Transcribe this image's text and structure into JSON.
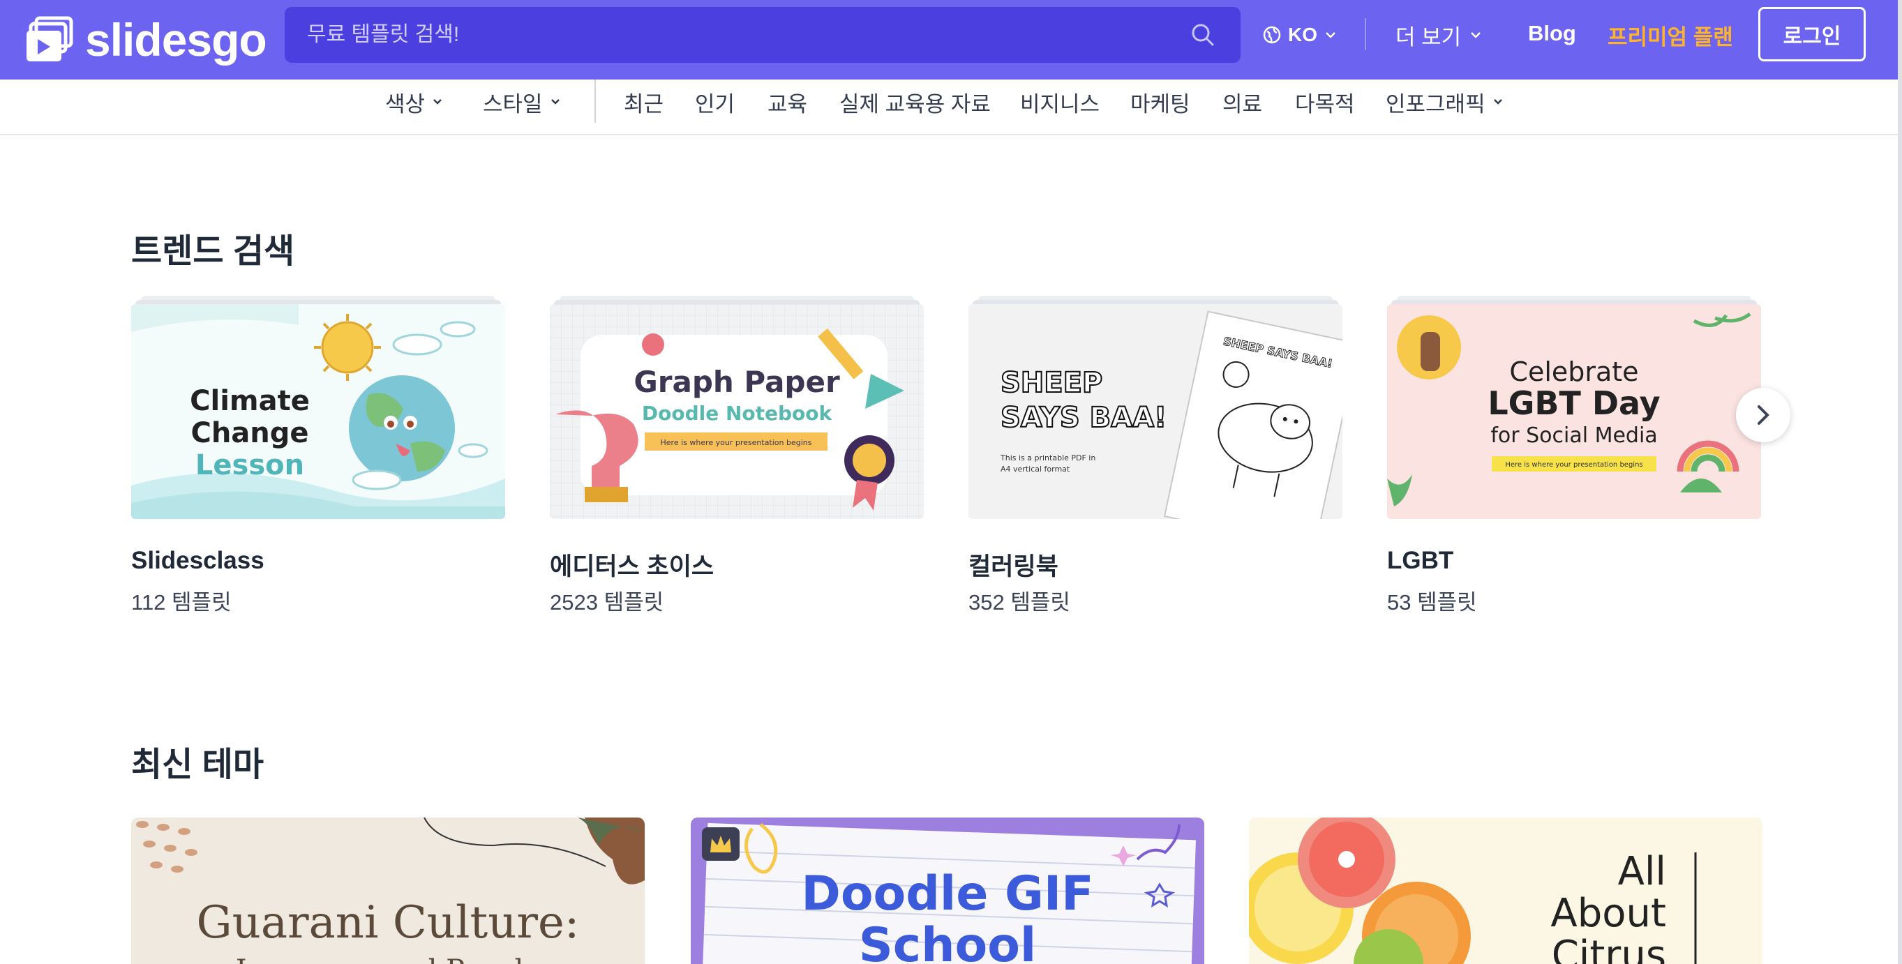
{
  "header": {
    "logo_text": "slidesgo",
    "search_placeholder": "무료 템플릿 검색!",
    "language": "KO",
    "more_label": "더 보기",
    "blog_label": "Blog",
    "premium_label": "프리미엄 플랜",
    "login_label": "로그인",
    "colors": {
      "bar": "#6c63f0",
      "search": "#4b3fe0",
      "premium": "#ffb32b"
    }
  },
  "nav": {
    "color_label": "색상",
    "style_label": "스타일",
    "recent": "최근",
    "popular": "인기",
    "education": "교육",
    "teaching_material": "실제 교육용 자료",
    "business": "비지니스",
    "marketing": "마케팅",
    "medical": "의료",
    "multipurpose": "다목적",
    "infographics": "인포그래픽"
  },
  "trending": {
    "title": "트렌드 검색",
    "cards": [
      {
        "title": "Slidesclass",
        "count": "112 템플릿",
        "thumb": {
          "line1": "Climate",
          "line2": "Change",
          "line3": "Lesson"
        }
      },
      {
        "title": "에디터스 초이스",
        "count": "2523 템플릿",
        "thumb": {
          "line1": "Graph Paper",
          "line2": "Doodle Notebook",
          "tag": "Here is where your presentation begins"
        }
      },
      {
        "title": "컬러링북",
        "count": "352 템플릿",
        "thumb": {
          "line1": "SHEEP",
          "line2": "SAYS BAA!",
          "sub1": "This is a printable PDF in",
          "sub2": "A4 vertical format",
          "page_title": "SHEEP SAYS BAA!"
        }
      },
      {
        "title": "LGBT",
        "count": "53 템플릿",
        "thumb": {
          "line1": "Celebrate",
          "line2": "LGBT Day",
          "line3": "for Social Media",
          "tag": "Here is where your presentation begins"
        }
      }
    ]
  },
  "latest": {
    "title": "최신 테마",
    "cards": [
      {
        "line1": "Guarani Culture:",
        "line2": "Language and People"
      },
      {
        "line1": "Doodle GIF",
        "line2": "School"
      },
      {
        "line1": "All",
        "line2": "About",
        "line3": "Citrus"
      }
    ]
  }
}
